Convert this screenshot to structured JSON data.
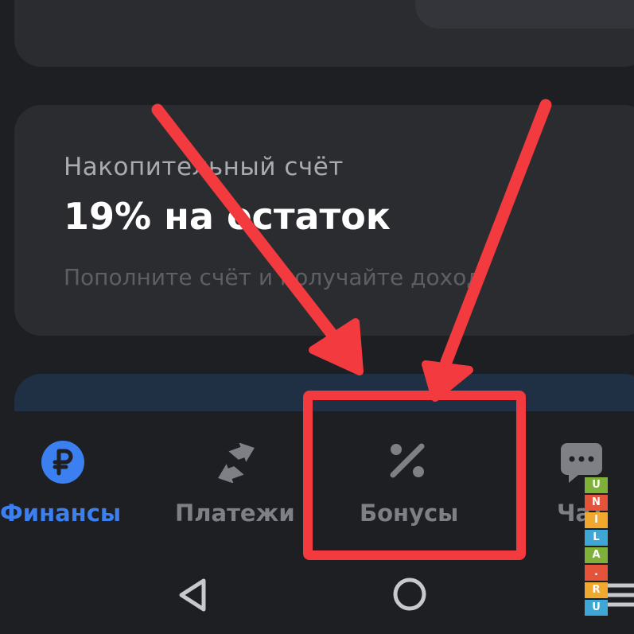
{
  "savings": {
    "label": "Накопительный счёт",
    "title": "19% на остаток",
    "subtitle": "Пополните счёт и получайте доход"
  },
  "nav": {
    "items": [
      {
        "label": "Финансы",
        "icon": "ruble-icon",
        "active": true
      },
      {
        "label": "Платежи",
        "icon": "transfer-icon",
        "active": false
      },
      {
        "label": "Бонусы",
        "icon": "percent-icon",
        "active": false
      },
      {
        "label": "Чат",
        "icon": "chat-icon",
        "active": false
      }
    ]
  },
  "system_nav": {
    "back": "back-icon",
    "home": "home-icon",
    "menu": "menu-icon"
  },
  "watermark": {
    "letters": [
      "U",
      "N",
      "I",
      "L",
      "A",
      ".",
      "R",
      "U"
    ]
  },
  "colors": {
    "background": "#1e1f22",
    "card": "#2b2c30",
    "accent_blue": "#3b7ff0",
    "inactive": "#7e8086",
    "annotation_red": "#f23a3f"
  }
}
